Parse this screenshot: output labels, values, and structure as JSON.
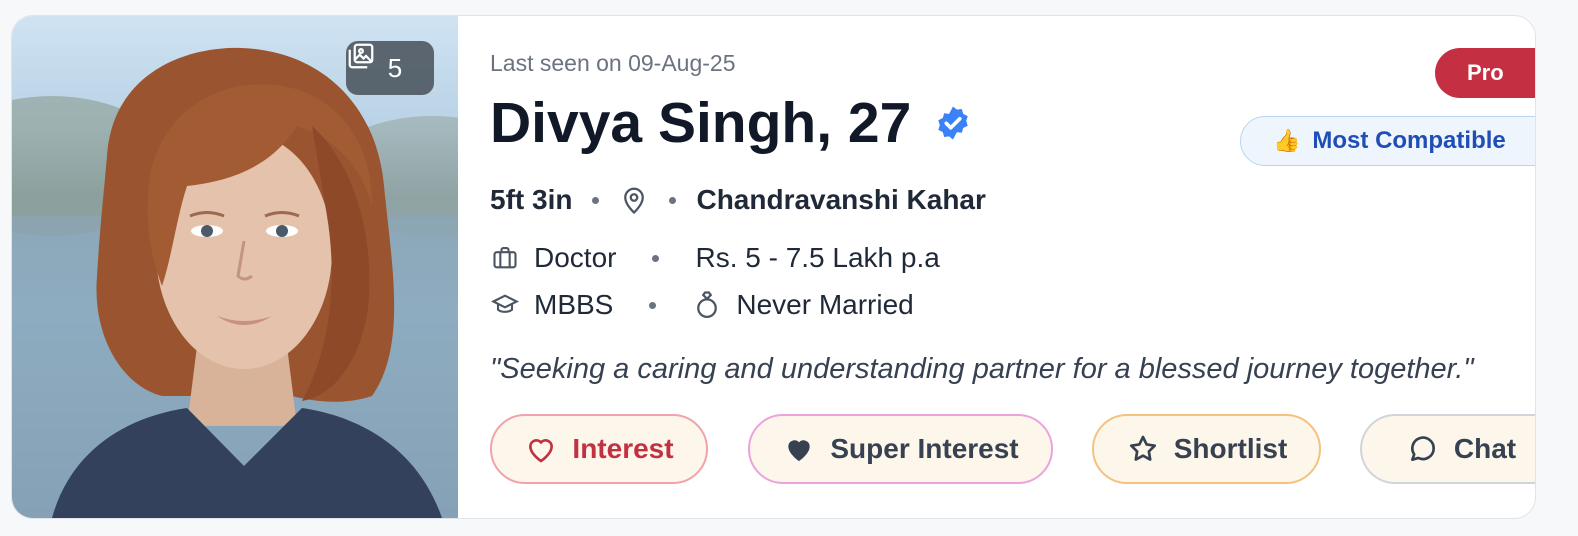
{
  "photo": {
    "count": "5"
  },
  "profile": {
    "last_seen": "Last seen on 09-Aug-25",
    "name": "Divya Singh, 27",
    "height": "5ft 3in",
    "community": "Chandravanshi Kahar",
    "profession": "Doctor",
    "income": "Rs. 5 - 7.5 Lakh p.a",
    "education": "MBBS",
    "marital_status": "Never Married",
    "about": "\"Seeking a caring and understanding partner for a blessed journey together.\""
  },
  "badges": {
    "pro": "Pro",
    "compatibility": "Most Compatible"
  },
  "actions": {
    "interest": "Interest",
    "super_interest": "Super Interest",
    "shortlist": "Shortlist",
    "chat": "Chat"
  },
  "colors": {
    "pro_bg": "#c52f42",
    "interest": "#c23142",
    "compat_text": "#1f4fb6",
    "verified": "#3b82f6"
  },
  "icons": [
    "gallery-icon",
    "verified-icon",
    "thumbs-up-icon",
    "location-pin-icon",
    "briefcase-icon",
    "graduation-cap-icon",
    "ring-icon",
    "heart-outline-icon",
    "heart-filled-icon",
    "star-icon",
    "chat-bubble-icon"
  ]
}
